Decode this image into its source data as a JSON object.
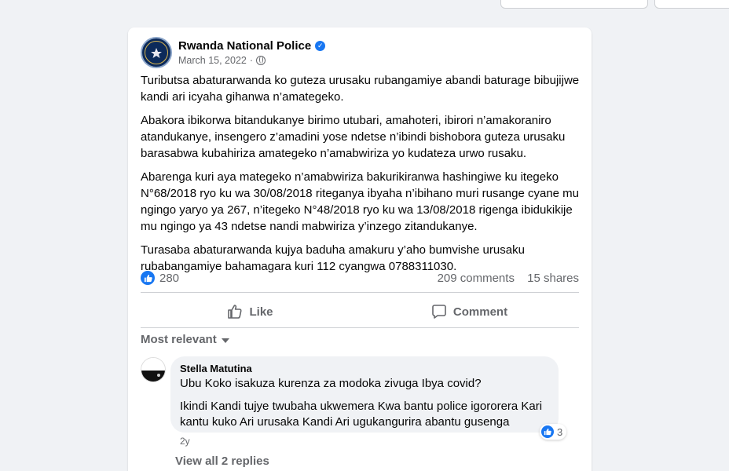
{
  "post": {
    "page_name": "Rwanda National Police",
    "date": "March 15, 2022",
    "date_sep": "·",
    "verified_icon": "verified-badge-icon",
    "privacy_icon": "globe-icon",
    "paragraphs": [
      "Tuributsa abaturarwanda ko guteza urusaku rubangamiye abandi baturage bibujijwe kandi ari icyaha gihanwa n’amategeko.",
      "Abakora ibikorwa bitandukanye birimo utubari, amahoteri, ibirori n’amakoraniro atandukanye, insengero z’amadini yose ndetse n’ibindi bishobora  guteza urusaku barasabwa kubahiriza amategeko n’amabwiriza yo kudateza urwo rusaku.",
      "Abarenga kuri aya mategeko n’amabwiriza bakurikiranwa hashingiwe ku itegeko N°68/2018 ryo ku wa 30/08/2018 riteganya ibyaha n’ibihano muri rusange cyane mu ngingo yaryo ya 267, n’itegeko N°48/2018 ryo ku wa 13/08/2018 rigenga ibidukikije mu ngingo ya 43 ndetse nandi mabwiriza y’inzego zitandukanye.",
      "Turasaba abaturarwanda kujya baduha amakuru y’aho bumvishe urusaku rubabangamiye bahamagara kuri 112 cyangwa 0788311030."
    ],
    "reaction_count": "280",
    "comments_count": "209 comments",
    "shares_count": "15 shares"
  },
  "actions": {
    "like_label": "Like",
    "comment_label": "Comment"
  },
  "comments_section": {
    "sort_label": "Most relevant",
    "view_replies": "View all 2 replies",
    "comment": {
      "author": "Stella Matutina",
      "lines": [
        "Ubu Koko isakuza kurenza za modoka zivuga Ibya covid?",
        "Ikindi Kandi tujye twubaha ukwemera Kwa bantu police igororera Kari kantu kuko Ari urusaka Kandi Ari ugukangurira abantu gusenga"
      ],
      "reaction_count": "3",
      "time": "2y"
    }
  },
  "colors": {
    "accent": "#1877f2",
    "background": "#f0f2f5",
    "secondary_text": "#65676b"
  }
}
